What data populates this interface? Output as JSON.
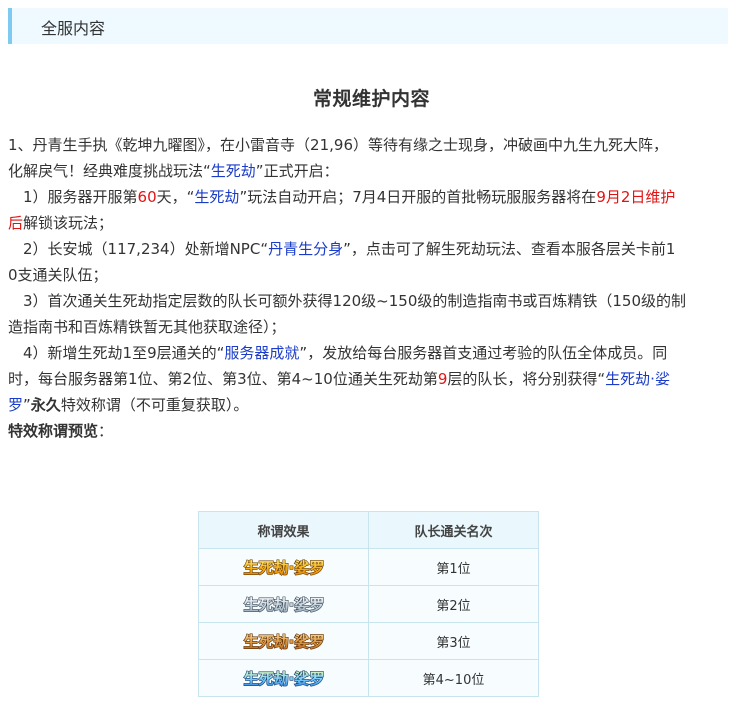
{
  "header": {
    "section_label": "全服内容"
  },
  "main_title": "常规维护内容",
  "item1": {
    "line_a": "1、丹青生手执《乾坤九曜图》，在小雷音寺（21,96）等待有缘之士现身，冲破画中九生九死大阵，",
    "line_b_pre": "化解戾气！经典难度挑战玩法“",
    "line_b_link": "生死劫",
    "line_b_post": "”正式开启："
  },
  "sub1": {
    "pre": "1）服务器开服第",
    "days": "60",
    "mid1": "天，“",
    "link": "生死劫",
    "mid2": "”玩法自动开启；7月4日开服的首批畅玩服服务器将在",
    "date_red": "9月2日维护",
    "line2_red": "后",
    "line2_post": "解锁该玩法；"
  },
  "sub2": {
    "pre": "2）长安城（117,234）处新增NPC“",
    "link": "丹青生分身",
    "post": "”，点击可了解生死劫玩法、查看本服各层关卡前1",
    "line2": "0支通关队伍；"
  },
  "sub3": {
    "line1": "3）首次通关生死劫指定层数的队长可额外获得120级~150级的制造指南书或百炼精铁（150级的制",
    "line2": "造指南书和百炼精铁暂无其他获取途径）；"
  },
  "sub4": {
    "pre": "4）新增生死劫1至9层通关的“",
    "link": "服务器成就",
    "post": "”，发放给每台服务器首支通过考验的队伍全体成员。同",
    "line2_pre": "时，每台服务器第1位、第2位、第3位、第4~10位通关生死劫第",
    "line2_red": "9",
    "line2_post": "层的队长，将分别获得“",
    "line2_link": "生死劫·娑",
    "line3_link": "罗",
    "line3_mid": "”",
    "line3_bold": "永久",
    "line3_post": "特效称谓（不可重复获取）。"
  },
  "preview_label": "特效称谓预览",
  "preview_colon": "：",
  "table": {
    "headers": [
      "称谓效果",
      "队长通关名次"
    ],
    "rows": [
      {
        "badge_text": "生死劫·娑罗",
        "rank": "第1位",
        "style": "gold"
      },
      {
        "badge_text": "生死劫·娑罗",
        "rank": "第2位",
        "style": "silver"
      },
      {
        "badge_text": "生死劫·娑罗",
        "rank": "第3位",
        "style": "bronze"
      },
      {
        "badge_text": "生死劫·娑罗",
        "rank": "第4~10位",
        "style": "blue"
      }
    ]
  },
  "colors": {
    "link_blue": "#1a3cc8",
    "highlight_red": "#e01414",
    "header_bar": "#7ecaf0",
    "header_bg": "#eefaff",
    "table_border": "#c8e4ee"
  }
}
